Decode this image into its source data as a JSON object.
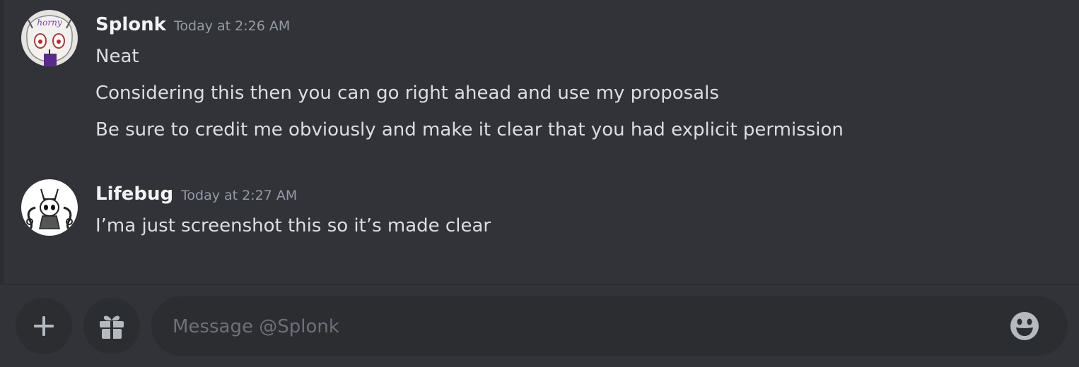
{
  "messages": [
    {
      "author": "Splonk",
      "timestamp": "Today at 2:26 AM",
      "avatar_text": "horny",
      "lines": [
        "Neat",
        "Considering this then you can go right ahead and use my proposals",
        "Be sure to credit me obviously and make it clear that you had explicit permission"
      ]
    },
    {
      "author": "Lifebug",
      "timestamp": "Today at 2:27 AM",
      "lines": [
        "I’ma just screenshot this so it’s made clear"
      ]
    }
  ],
  "composer": {
    "placeholder": "Message @Splonk",
    "add_icon": "plus-icon",
    "gift_icon": "gift-icon",
    "emoji_icon": "emoji-icon"
  },
  "colors": {
    "background": "#313338",
    "input_background": "#2b2d31",
    "username": "#f2f3f5",
    "timestamp": "#949ba4",
    "message_text": "#dbdee1",
    "placeholder": "#6d7079",
    "icon": "#b5bac1"
  }
}
